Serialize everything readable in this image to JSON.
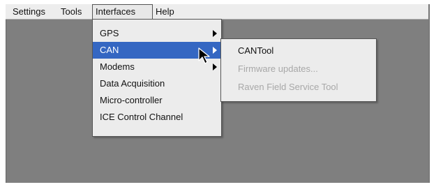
{
  "menubar": {
    "items": [
      {
        "label": "Settings"
      },
      {
        "label": "Tools"
      },
      {
        "label": "Interfaces"
      },
      {
        "label": "Help"
      }
    ],
    "active": "Interfaces"
  },
  "interfaces_menu": {
    "items": [
      {
        "label": "GPS",
        "submenu": true
      },
      {
        "label": "CAN",
        "submenu": true,
        "highlighted": true
      },
      {
        "label": "Modems",
        "submenu": true
      },
      {
        "label": "Data Acquisition",
        "submenu": false
      },
      {
        "label": "Micro-controller",
        "submenu": false
      },
      {
        "label": "ICE Control Channel",
        "submenu": false
      }
    ]
  },
  "can_submenu": {
    "items": [
      {
        "label": "CANTool",
        "enabled": true
      },
      {
        "label": "Firmware updates...",
        "enabled": false
      },
      {
        "label": "Raven Field Service Tool",
        "enabled": false
      }
    ]
  },
  "colors": {
    "window_background": "#7f7f7f",
    "menu_background": "#ececec",
    "highlight": "#3567c2",
    "disabled_text": "#a8a8a8"
  },
  "icons": {
    "submenu_arrow": "arrow-right-icon",
    "cursor": "mouse-pointer-icon"
  }
}
